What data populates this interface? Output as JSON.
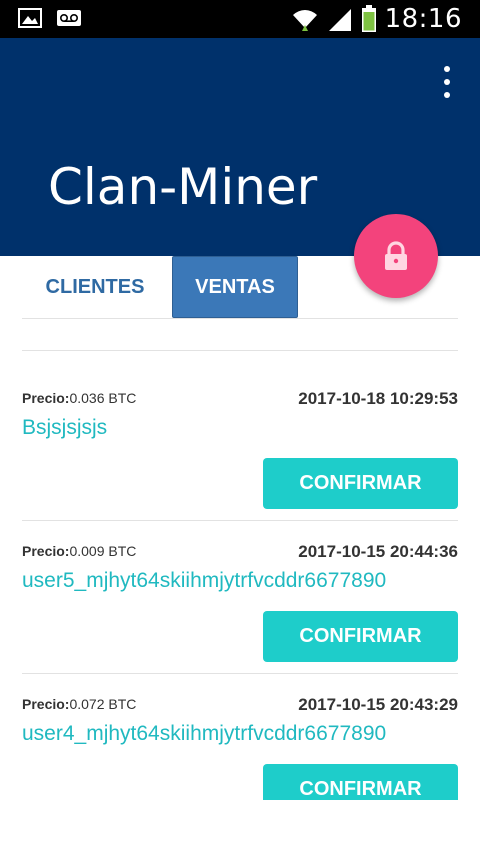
{
  "status_bar": {
    "time": "18:16",
    "icons": [
      "image-notification-icon",
      "voicemail-icon",
      "wifi-icon",
      "signal-icon",
      "battery-icon"
    ]
  },
  "app_bar": {
    "title": "Clan-Miner",
    "background": "#00316b",
    "menu_icon": "more-vert-icon"
  },
  "fab": {
    "icon": "lock-icon",
    "color": "#f3437c"
  },
  "tabs": [
    {
      "label": "CLIENTES",
      "active": false
    },
    {
      "label": "VENTAS",
      "active": true
    }
  ],
  "sales": [
    {
      "precio_label": "Precio:",
      "precio": "0.036 BTC",
      "fecha": "2017-10-18 10:29:53",
      "user": "Bsjsjsjsjs",
      "action": "CONFIRMAR"
    },
    {
      "precio_label": "Precio:",
      "precio": "0.009 BTC",
      "fecha": "2017-10-15 20:44:36",
      "user": "user5_mjhyt64skiihmjytrfvcddr6677890",
      "action": "CONFIRMAR"
    },
    {
      "precio_label": "Precio:",
      "precio": "0.072 BTC",
      "fecha": "2017-10-15 20:43:29",
      "user": "user4_mjhyt64skiihmjytrfvcddr6677890",
      "action": "CONFIRMAR"
    }
  ],
  "colors": {
    "accent_link": "#20b9c0",
    "confirm_button": "#1ecdca",
    "tab_active": "#3b78b8",
    "tab_inactive_text": "#2f6aa3"
  }
}
